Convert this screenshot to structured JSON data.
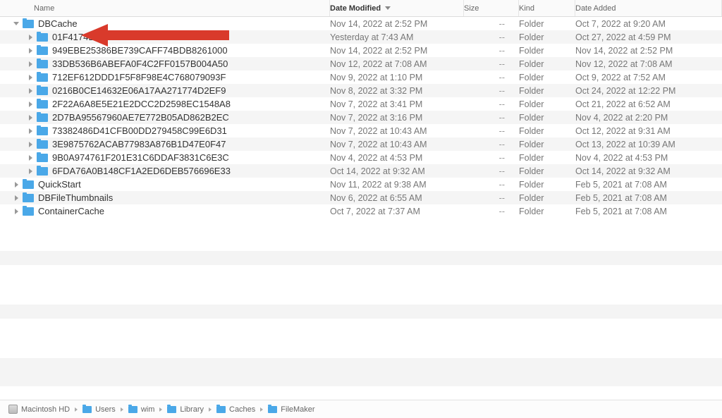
{
  "columns": {
    "name": "Name",
    "date_modified": "Date Modified",
    "size": "Size",
    "kind": "Kind",
    "date_added": "Date Added"
  },
  "size_placeholder": "--",
  "kind_folder": "Folder",
  "rows": [
    {
      "indent": 0,
      "expanded": true,
      "name": "DBCache",
      "date": "Nov 14, 2022 at 2:52 PM",
      "added": "Oct 7, 2022 at 9:20 AM"
    },
    {
      "indent": 1,
      "expanded": false,
      "name": "01F4174BFC1459D0FAEE6219F7FB4886",
      "date": "Yesterday at 7:43 AM",
      "added": "Oct 27, 2022 at 4:59 PM"
    },
    {
      "indent": 1,
      "expanded": false,
      "name": "949EBE25386BE739CAFF74BDB8261000",
      "date": "Nov 14, 2022 at 2:52 PM",
      "added": "Nov 14, 2022 at 2:52 PM"
    },
    {
      "indent": 1,
      "expanded": false,
      "name": "33DB536B6ABEFA0F4C2FF0157B004A50",
      "date": "Nov 12, 2022 at 7:08 AM",
      "added": "Nov 12, 2022 at 7:08 AM"
    },
    {
      "indent": 1,
      "expanded": false,
      "name": "712EF612DDD1F5F8F98E4C768079093F",
      "date": "Nov 9, 2022 at 1:10 PM",
      "added": "Oct 9, 2022 at 7:52 AM"
    },
    {
      "indent": 1,
      "expanded": false,
      "name": "0216B0CE14632E06A17AA271774D2EF9",
      "date": "Nov 8, 2022 at 3:32 PM",
      "added": "Oct 24, 2022 at 12:22 PM"
    },
    {
      "indent": 1,
      "expanded": false,
      "name": "2F22A6A8E5E21E2DCC2D2598EC1548A8",
      "date": "Nov 7, 2022 at 3:41 PM",
      "added": "Oct 21, 2022 at 6:52 AM"
    },
    {
      "indent": 1,
      "expanded": false,
      "name": "2D7BA95567960AE7E772B05AD862B2EC",
      "date": "Nov 7, 2022 at 3:16 PM",
      "added": "Nov 4, 2022 at 2:20 PM"
    },
    {
      "indent": 1,
      "expanded": false,
      "name": "73382486D41CFB00DD279458C99E6D31",
      "date": "Nov 7, 2022 at 10:43 AM",
      "added": "Oct 12, 2022 at 9:31 AM"
    },
    {
      "indent": 1,
      "expanded": false,
      "name": "3E9875762ACAB77983A876B1D47E0F47",
      "date": "Nov 7, 2022 at 10:43 AM",
      "added": "Oct 13, 2022 at 10:39 AM"
    },
    {
      "indent": 1,
      "expanded": false,
      "name": "9B0A974761F201E31C6DDAF3831C6E3C",
      "date": "Nov 4, 2022 at 4:53 PM",
      "added": "Nov 4, 2022 at 4:53 PM"
    },
    {
      "indent": 1,
      "expanded": false,
      "name": "6FDA76A0B148CF1A2ED6DEB576696E33",
      "date": "Oct 14, 2022 at 9:32 AM",
      "added": "Oct 14, 2022 at 9:32 AM"
    },
    {
      "indent": 0,
      "expanded": false,
      "name": "QuickStart",
      "date": "Nov 11, 2022 at 9:38 AM",
      "added": "Feb 5, 2021 at 7:08 AM"
    },
    {
      "indent": 0,
      "expanded": false,
      "name": "DBFileThumbnails",
      "date": "Nov 6, 2022 at 6:55 AM",
      "added": "Feb 5, 2021 at 7:08 AM"
    },
    {
      "indent": 0,
      "expanded": false,
      "name": "ContainerCache",
      "date": "Oct 7, 2022 at 7:37 AM",
      "added": "Feb 5, 2021 at 7:08 AM"
    }
  ],
  "path": [
    {
      "icon": "disk",
      "label": "Macintosh HD"
    },
    {
      "icon": "folder",
      "label": "Users"
    },
    {
      "icon": "folder",
      "label": "wim"
    },
    {
      "icon": "folder",
      "label": "Library"
    },
    {
      "icon": "folder",
      "label": "Caches"
    },
    {
      "icon": "folder",
      "label": "FileMaker"
    }
  ]
}
